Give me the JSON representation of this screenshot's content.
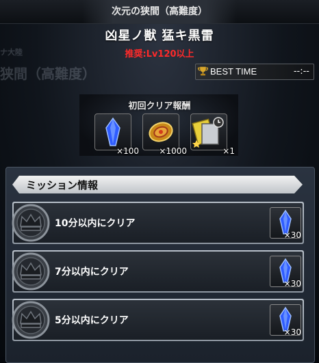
{
  "header": {
    "title": "次元の狭間（高難度）"
  },
  "quest": {
    "name": "凶星ノ獣 猛キ黒雷",
    "recommend": "推奨:Lv120以上"
  },
  "best_time": {
    "label": "BEST TIME",
    "value": "--:--"
  },
  "first_clear": {
    "label": "初回クリア報酬",
    "rewards": [
      {
        "icon": "blue-crystal-icon",
        "qty": "×100"
      },
      {
        "icon": "gold-medal-icon",
        "qty": "×1000"
      },
      {
        "icon": "summon-ticket-icon",
        "qty": "×1"
      }
    ]
  },
  "mission": {
    "header": "ミッション情報",
    "items": [
      {
        "label": "10分以内にクリア",
        "reward_icon": "blue-crystal-icon",
        "qty": "×30"
      },
      {
        "label": "7分以内にクリア",
        "reward_icon": "blue-crystal-icon",
        "qty": "×30"
      },
      {
        "label": "5分以内にクリア",
        "reward_icon": "blue-crystal-icon",
        "qty": "×30"
      }
    ]
  },
  "colors": {
    "recommend": "#ff2a2a",
    "accent": "#d9a62a",
    "crystal": "#2f5cff"
  }
}
